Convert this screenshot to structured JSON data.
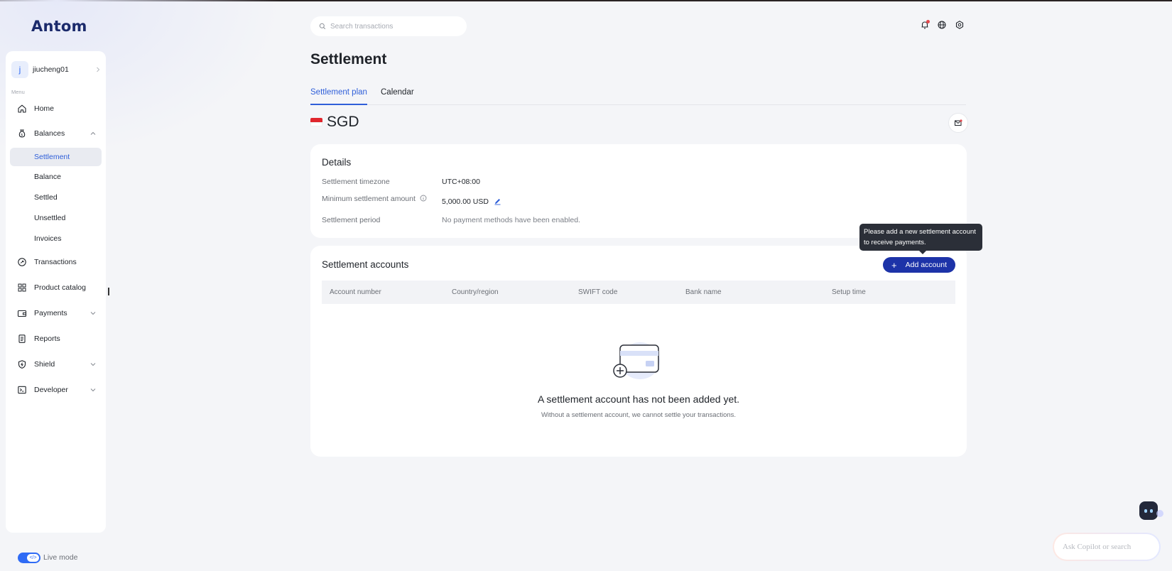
{
  "brand": {
    "logo_text": "Antom"
  },
  "user": {
    "avatar_initial": "j",
    "name": "jiucheng01"
  },
  "sidebar": {
    "menu_label": "Menu",
    "items": [
      {
        "label": "Home",
        "icon": "home-icon"
      },
      {
        "label": "Balances",
        "icon": "balances-icon",
        "expanded": true,
        "children": [
          {
            "label": "Settlement",
            "active": true
          },
          {
            "label": "Balance"
          },
          {
            "label": "Settled"
          },
          {
            "label": "Unsettled"
          },
          {
            "label": "Invoices"
          }
        ]
      },
      {
        "label": "Transactions",
        "icon": "transactions-icon"
      },
      {
        "label": "Product catalog",
        "icon": "grid-icon"
      },
      {
        "label": "Payments",
        "icon": "wallet-icon",
        "expanded": false
      },
      {
        "label": "Reports",
        "icon": "report-icon"
      },
      {
        "label": "Shield",
        "icon": "shield-icon",
        "expanded": false
      },
      {
        "label": "Developer",
        "icon": "terminal-icon",
        "expanded": false
      }
    ],
    "live_mode_label": "Live mode",
    "live_mode_on": true
  },
  "header": {
    "search_placeholder": "Search transactions",
    "icons": [
      "bell-icon",
      "globe-icon",
      "settings-icon"
    ]
  },
  "page": {
    "title": "Settlement",
    "tabs": [
      {
        "label": "Settlement plan",
        "active": true
      },
      {
        "label": "Calendar",
        "active": false
      }
    ],
    "currency": "SGD"
  },
  "details": {
    "title": "Details",
    "rows": [
      {
        "label": "Settlement timezone",
        "value": "UTC+08:00"
      },
      {
        "label": "Minimum settlement amount",
        "value": "5,000.00 USD"
      },
      {
        "label": "Settlement period",
        "value": "No payment methods have been enabled."
      }
    ]
  },
  "accounts": {
    "title": "Settlement accounts",
    "add_button": "Add account",
    "tooltip": "Please add a new settlement account to receive payments.",
    "columns": [
      "Account number",
      "Country/region",
      "SWIFT code",
      "Bank name",
      "Setup time"
    ],
    "empty_title": "A settlement account has not been added yet.",
    "empty_subtitle": "Without a settlement account, we cannot settle your transactions."
  },
  "copilot": {
    "placeholder": "Ask Copilot or search"
  },
  "colors": {
    "accent": "#2f5fd9",
    "primary_button": "#1d33a8",
    "notification_dot": "#e5484d"
  }
}
